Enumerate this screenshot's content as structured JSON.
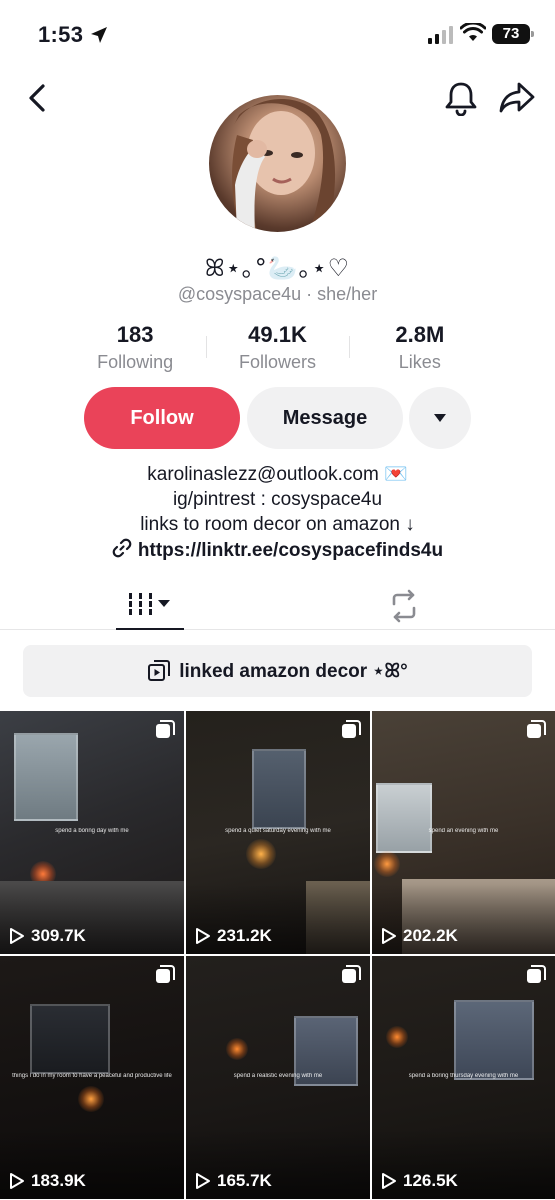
{
  "status_bar": {
    "time": "1:53",
    "battery": "73"
  },
  "profile": {
    "display_name": "ꕤ⋆｡°🦢｡⋆♡",
    "handle_line": "@cosyspace4u · she/her"
  },
  "stats": [
    {
      "value": "183",
      "label": "Following"
    },
    {
      "value": "49.1K",
      "label": "Followers"
    },
    {
      "value": "2.8M",
      "label": "Likes"
    }
  ],
  "actions": {
    "follow": "Follow",
    "message": "Message"
  },
  "bio": {
    "lines": [
      "karolinaslezz@outlook.com 💌",
      "ig/pintrest : cosyspace4u",
      "links to room decor on amazon ↓"
    ],
    "link": "https://linktr.ee/cosyspacefinds4u"
  },
  "playlist": {
    "label": "linked amazon decor ⋆ꕤ°"
  },
  "videos": [
    {
      "views": "309.7K",
      "caption": "spend a boring day with me"
    },
    {
      "views": "231.2K",
      "caption": "spend a quiet saturday evening with me"
    },
    {
      "views": "202.2K",
      "caption": "spend an evening with me"
    },
    {
      "views": "183.9K",
      "caption": "things i do in my room to have a peaceful and productive life"
    },
    {
      "views": "165.7K",
      "caption": "spend a realistic evening with me"
    },
    {
      "views": "126.5K",
      "caption": "spend a boring thursday evening with me"
    }
  ],
  "colors": {
    "accent": "#ea4359",
    "muted": "#8a8b91",
    "button_bg": "#f1f1f2"
  },
  "icons": {
    "back": "chevron-left-icon",
    "bell": "bell-icon",
    "share": "share-arrow-icon",
    "more": "caret-down-icon",
    "videos_tab": "grid-bars-icon",
    "repost_tab": "repost-icon",
    "playlist": "playlist-icon",
    "play": "play-icon",
    "multi": "multi-image-icon"
  }
}
